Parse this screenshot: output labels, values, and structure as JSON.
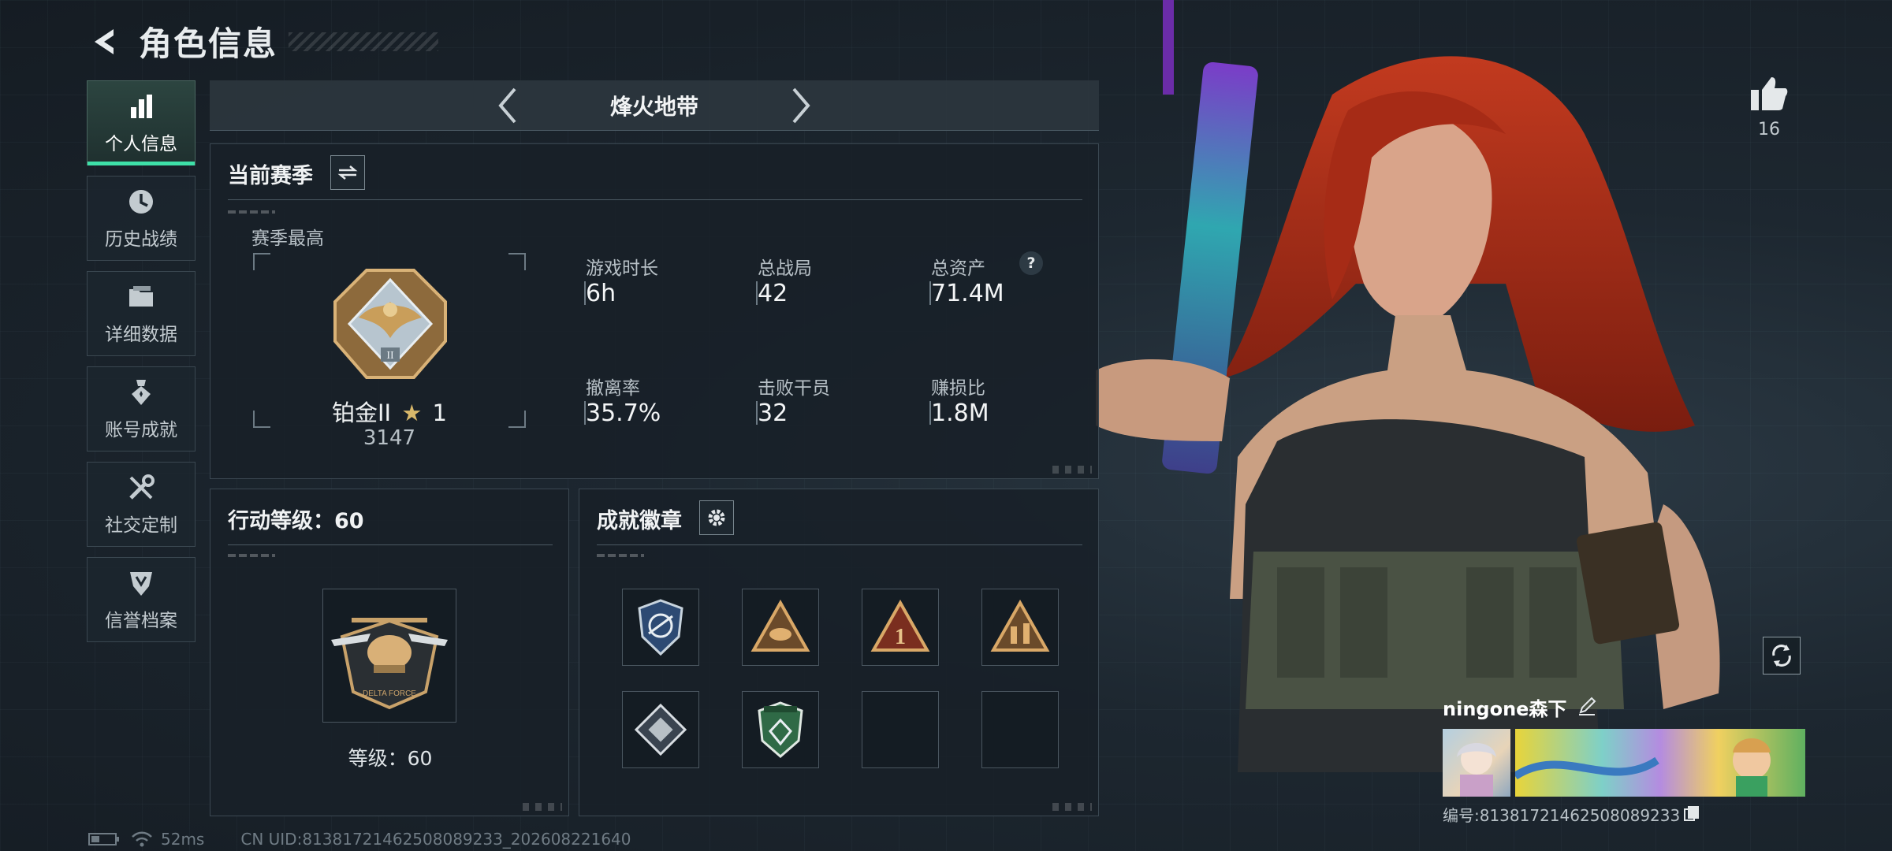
{
  "header": {
    "title": "角色信息"
  },
  "sidebar": {
    "items": [
      {
        "label": "个人信息",
        "active": true
      },
      {
        "label": "历史战绩"
      },
      {
        "label": "详细数据"
      },
      {
        "label": "账号成就"
      },
      {
        "label": "社交定制"
      },
      {
        "label": "信誉档案"
      }
    ]
  },
  "mode": {
    "name": "烽火地带"
  },
  "season": {
    "title": "当前赛季",
    "best_label": "赛季最高",
    "rank_name": "铂金II",
    "rank_stars": "1",
    "rank_score": "3147",
    "stats": [
      {
        "label": "游戏时长",
        "value": "6h"
      },
      {
        "label": "总战局",
        "value": "42"
      },
      {
        "label": "总资产",
        "value": "71.4M",
        "help": "?"
      },
      {
        "label": "撤离率",
        "value": "35.7%"
      },
      {
        "label": "击败干员",
        "value": "32"
      },
      {
        "label": "赚损比",
        "value": "1.8M"
      }
    ]
  },
  "action_level": {
    "title": "行动等级：60",
    "level_label": "等级：60"
  },
  "badges": {
    "title": "成就徽章"
  },
  "likes": {
    "count": "16"
  },
  "player": {
    "name": "ningone森下",
    "id_line": "编号:8138172146250808923​3"
  },
  "footer": {
    "ping": "52ms",
    "uid": "CN UID:8138172146250808923​3_202608221640"
  },
  "colors": {
    "accent": "#3ee0a8",
    "panel_bg": "#18202a",
    "hair": "#b8321c"
  }
}
